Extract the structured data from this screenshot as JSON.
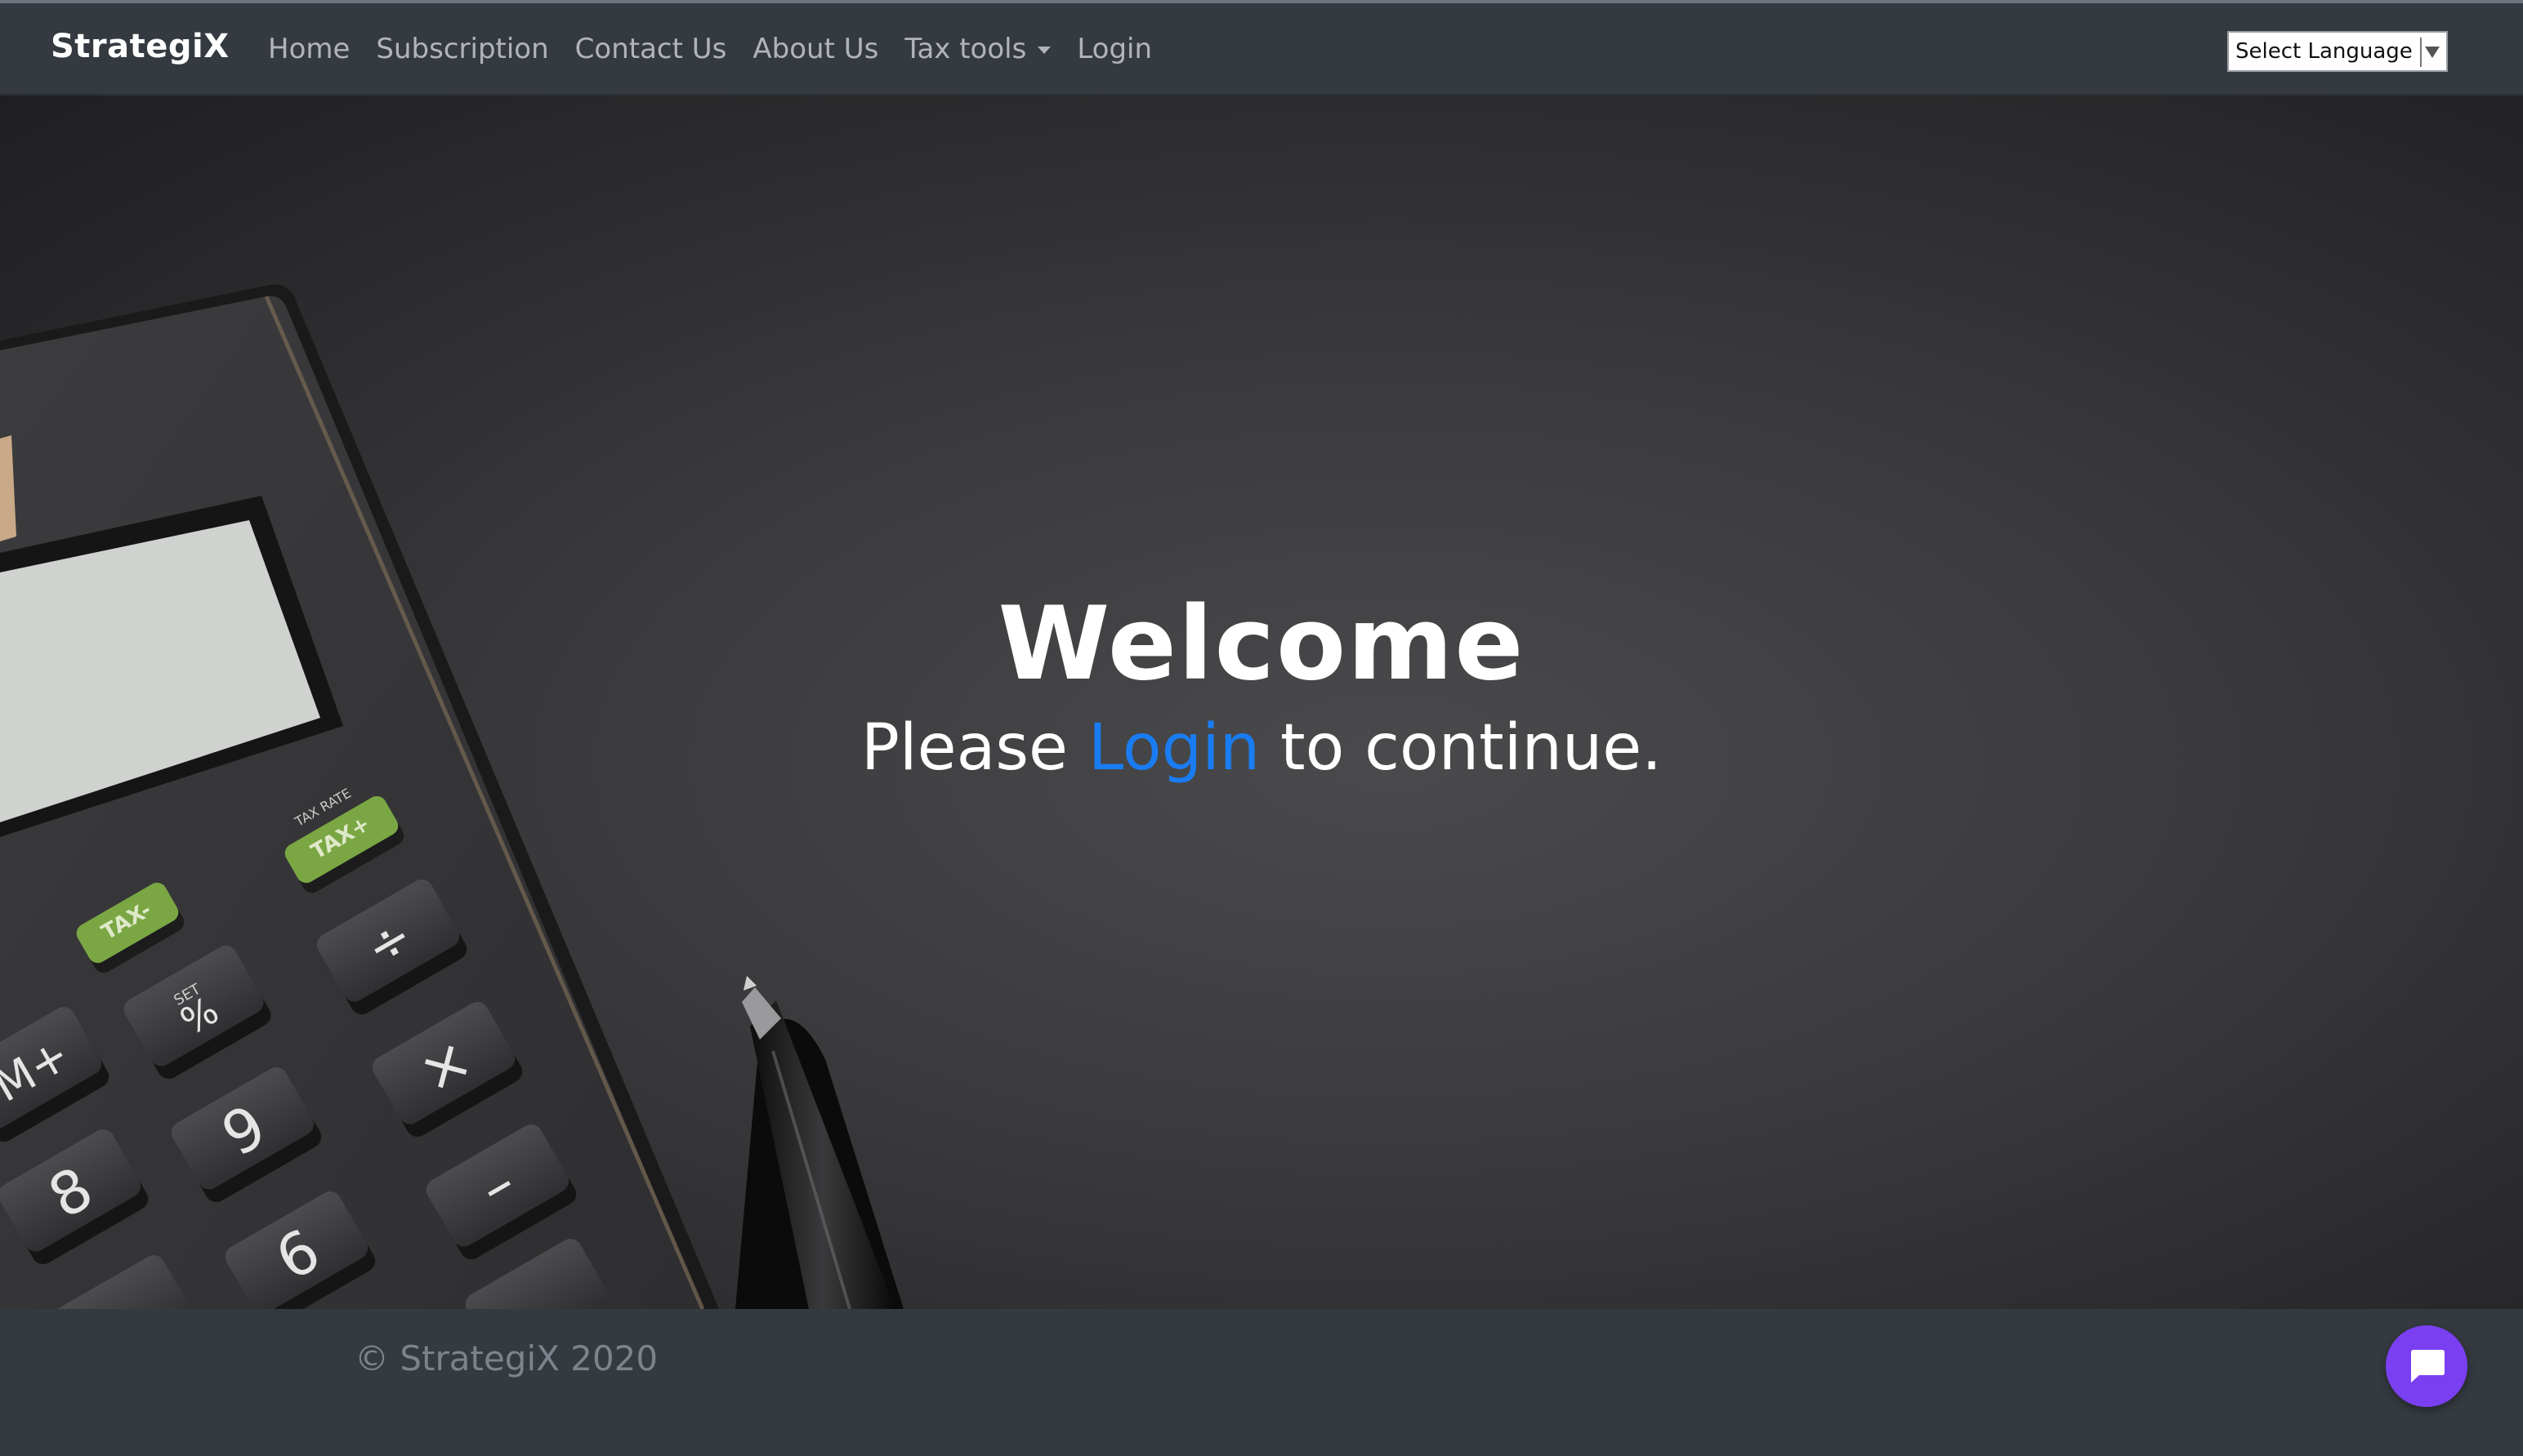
{
  "navbar": {
    "brand": "StrategiX",
    "links": [
      "Home",
      "Subscription",
      "Contact Us",
      "About Us"
    ],
    "tax_tools": "Tax tools",
    "login": "Login",
    "language": "Select Language"
  },
  "hero": {
    "title": "Welcome",
    "subtitle_before": "Please ",
    "subtitle_link": "Login",
    "subtitle_after": " to continue.",
    "calculator_keys": [
      "TAX-",
      "TAX+",
      "TAX RATE",
      "SET",
      "%",
      "÷",
      "M+",
      "9",
      "×",
      "8",
      "6",
      "–"
    ]
  },
  "footer": {
    "copyright": "© StrategiX 2020"
  },
  "colors": {
    "navbar_bg": "#343a40",
    "link_color": "#1a7cf2",
    "chat_button": "#7b3ff2"
  },
  "icons": {
    "chat": "chat-bubble-icon",
    "dropdown": "caret-down-icon"
  }
}
